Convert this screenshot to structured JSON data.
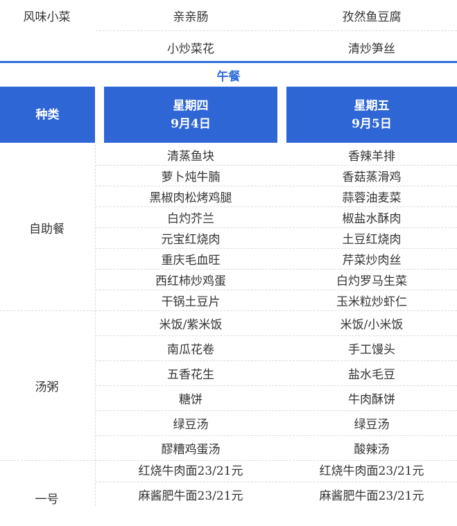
{
  "top": {
    "category": "风味小菜",
    "rows": [
      {
        "thu": "亲亲肠",
        "fri": "孜然鱼豆腐"
      },
      {
        "thu": "小炒菜花",
        "fri": "清炒笋丝"
      }
    ]
  },
  "lunch": {
    "title": "午餐",
    "header": {
      "kind": "种类",
      "thu_day": "星期四",
      "thu_date": "9月4日",
      "fri_day": "星期五",
      "fri_date": "9月5日"
    },
    "buffet": {
      "category": "自助餐",
      "rows": [
        {
          "thu": "清蒸鱼块",
          "fri": "香辣羊排"
        },
        {
          "thu": "萝卜炖牛腩",
          "fri": "香菇蒸滑鸡"
        },
        {
          "thu": "黑椒肉松烤鸡腿",
          "fri": "蒜蓉油麦菜"
        },
        {
          "thu": "白灼芥兰",
          "fri": "椒盐水酥肉"
        },
        {
          "thu": "元宝红烧肉",
          "fri": "土豆红烧肉"
        },
        {
          "thu": "重庆毛血旺",
          "fri": "芹菜炒肉丝"
        },
        {
          "thu": "西红柿炒鸡蛋",
          "fri": "白灼罗马生菜"
        },
        {
          "thu": "干锅土豆片",
          "fri": "玉米粒炒虾仁"
        }
      ]
    },
    "soup": {
      "category": "汤粥",
      "rows": [
        {
          "thu": "米饭/紫米饭",
          "fri": "米饭/小米饭"
        },
        {
          "thu": "南瓜花卷",
          "fri": "手工馒头"
        },
        {
          "thu": "五香花生",
          "fri": "盐水毛豆"
        },
        {
          "thu": "糖饼",
          "fri": "牛肉酥饼"
        },
        {
          "thu": "绿豆汤",
          "fri": "绿豆汤"
        },
        {
          "thu": "醪糟鸡蛋汤",
          "fri": "酸辣汤"
        }
      ]
    },
    "no1": {
      "category": "一号",
      "rows": [
        {
          "thu": "红烧牛肉面23/21元",
          "fri": "红烧牛肉面23/21元"
        },
        {
          "thu": "麻酱肥牛面23/21元",
          "fri": "麻酱肥牛面23/21元"
        }
      ]
    }
  },
  "colors": {
    "accent": "#2e6bd8",
    "header_bg": "#2f66d6",
    "divider": "#dcdcdc"
  }
}
